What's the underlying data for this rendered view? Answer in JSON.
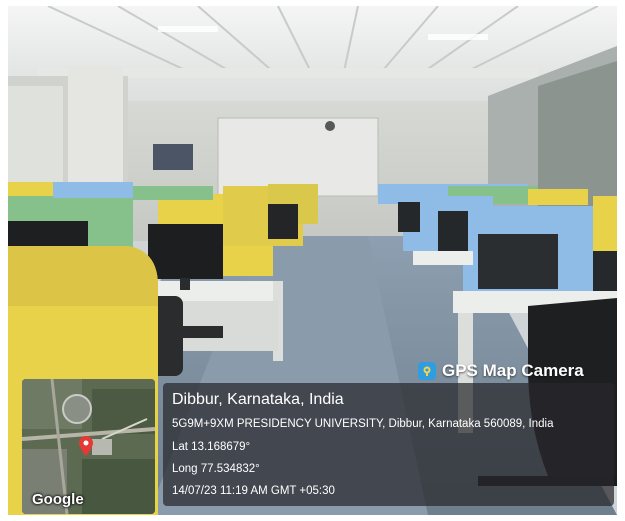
{
  "overlay": {
    "app_name": "GPS Map Camera",
    "location_title": "Dibbur, Karnataka, India",
    "address": "5G9M+9XM PRESIDENCY UNIVERSITY, Dibbur, Karnataka 560089, India",
    "latitude": "Lat 13.168679°",
    "longitude": "Long 77.534832°",
    "datetime": "14/07/23 11:19 AM GMT +05:30",
    "map_attribution": "Google"
  },
  "colors": {
    "partition_yellow": "#e8d24a",
    "partition_blue": "#8fbce6",
    "partition_green": "#86c08a",
    "overlay_panel": "#2a2a2f"
  }
}
